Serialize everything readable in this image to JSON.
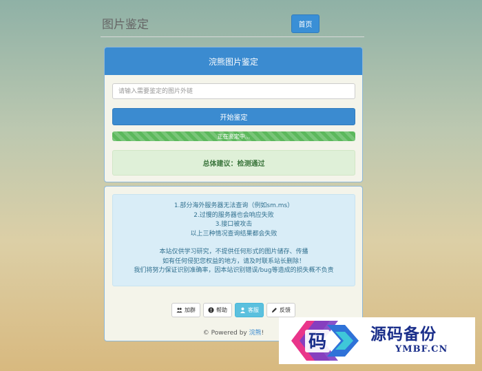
{
  "header": {
    "title": "图片鉴定",
    "home_label": "首页"
  },
  "checker": {
    "heading": "浣熊图片鉴定",
    "input_placeholder": "请输入需要鉴定的图片外链",
    "input_value": "",
    "start_label": "开始鉴定",
    "progress_text": "正在鉴定中...",
    "progress_percent": 100,
    "result_text": "总体建议：检测通过"
  },
  "notice": {
    "lines_a": [
      "1.部分海外服务器无法查询（例如sm.ms）",
      "2.过慢的服务器也会响应失败",
      "3.接口被攻击",
      "以上三种情况查询结果都会失败"
    ],
    "lines_b": [
      "本站仅供学习研究，不提供任何形式的图片储存、传播",
      "如有任何侵犯您权益的地方，请及时联系站长删除！",
      "我们将努力保证识别准确率，因本站识别错误/bug等造成的损失概不负责"
    ]
  },
  "actions": [
    {
      "label": "加群",
      "icon": "users-icon"
    },
    {
      "label": "帮助",
      "icon": "help-icon"
    },
    {
      "label": "客服",
      "icon": "user-icon"
    },
    {
      "label": "反馈",
      "icon": "pencil-icon"
    }
  ],
  "footer": {
    "prefix": "© Powered by",
    "link": "浣熊",
    "suffix": "!"
  },
  "watermark": {
    "logo_char": "码",
    "title": "源码备份",
    "subtitle": "YMBF.CN"
  },
  "colors": {
    "primary": "#3b8bd0",
    "success": "#5cb85c",
    "info_bg": "#d9edf7",
    "active_btn": "#5bc0de"
  }
}
